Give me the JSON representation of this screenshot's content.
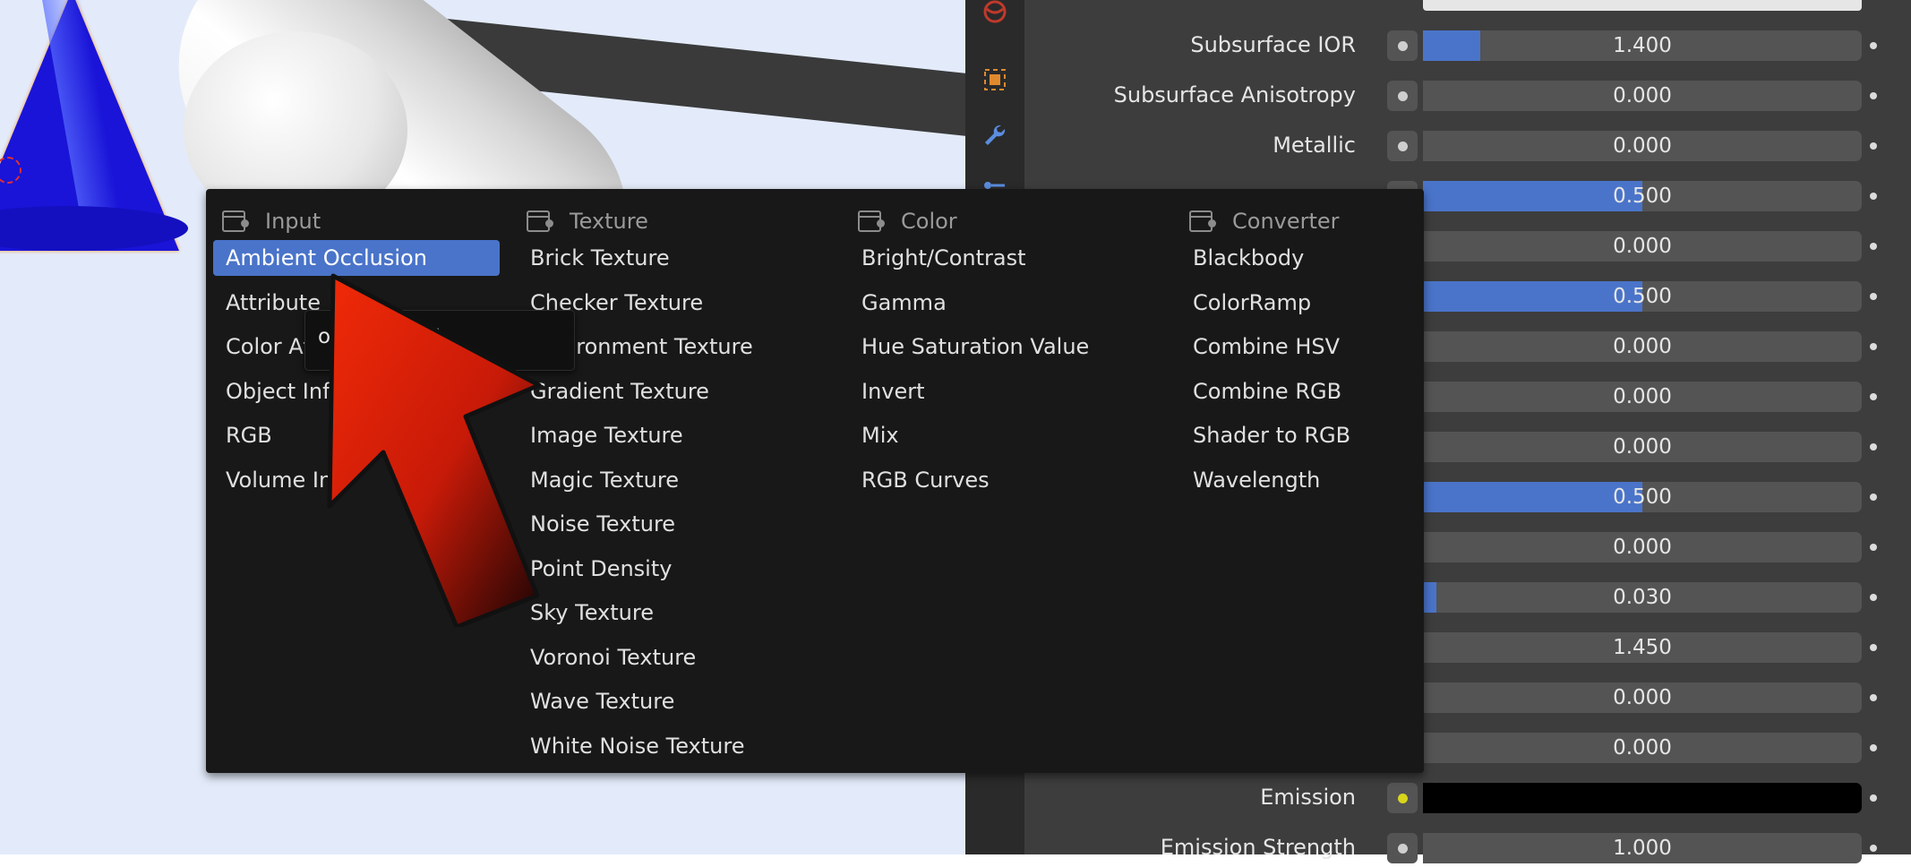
{
  "menu": {
    "columns": [
      {
        "header": "Input",
        "items": [
          "Ambient Occlusion",
          "Attribute",
          "Color Attrib",
          "Object Info",
          "RGB",
          "Volume Inf"
        ]
      },
      {
        "header": "Texture",
        "items": [
          "Brick Texture",
          "Checker Texture",
          "Environment Texture",
          "Gradient Texture",
          "Image Texture",
          "Magic Texture",
          "Noise Texture",
          "Point Density",
          "Sky Texture",
          "Voronoi Texture",
          "Wave Texture",
          "White Noise Texture"
        ]
      },
      {
        "header": "Color",
        "items": [
          "Bright/Contrast",
          "Gamma",
          "Hue Saturation Value",
          "Invert",
          "Mix",
          "RGB Curves"
        ]
      },
      {
        "header": "Converter",
        "items": [
          "Blackbody",
          "ColorRamp",
          "Combine HSV",
          "Combine RGB",
          "Shader to RGB",
          "Wavelength"
        ]
      }
    ],
    "active_item": "Ambient Occlusion"
  },
  "tooltip": {
    "text": "ode to input."
  },
  "properties": {
    "rows": [
      {
        "label": "Subsurface IOR",
        "value": "1.400",
        "fill": 0.13
      },
      {
        "label": "Subsurface Anisotropy",
        "value": "0.000",
        "fill": 0
      },
      {
        "label": "Metallic",
        "value": "0.000",
        "fill": 0
      },
      {
        "label": "",
        "value": "0.500",
        "fill": 0.5
      },
      {
        "label": "",
        "value": "0.000",
        "fill": 0
      },
      {
        "label": "",
        "value": "0.500",
        "fill": 0.5
      },
      {
        "label": "",
        "value": "0.000",
        "fill": 0
      },
      {
        "label": "",
        "value": "0.000",
        "fill": 0
      },
      {
        "label": "",
        "value": "0.000",
        "fill": 0
      },
      {
        "label": "",
        "value": "0.500",
        "fill": 0.5
      },
      {
        "label": "",
        "value": "0.000",
        "fill": 0
      },
      {
        "label": "",
        "value": "0.030",
        "fill": 0.03
      },
      {
        "label": "",
        "value": "1.450",
        "fill": 0
      },
      {
        "label": "",
        "value": "0.000",
        "fill": 0
      },
      {
        "label": "",
        "value": "0.000",
        "fill": 0
      },
      {
        "label": "Emission",
        "value": "",
        "fill": 0,
        "color": "#000000",
        "socket": "yellow"
      },
      {
        "label": "Emission Strength",
        "value": "1.000",
        "fill": 0
      }
    ]
  },
  "colors": {
    "accent": "#4a74c9",
    "menu_bg": "#181818",
    "panel_bg": "#3d3d3d",
    "arrow": "#e8200a"
  },
  "icons": [
    "globe-icon",
    "object-icon",
    "wrench-icon",
    "constraint-icon",
    "node-category-icon"
  ]
}
